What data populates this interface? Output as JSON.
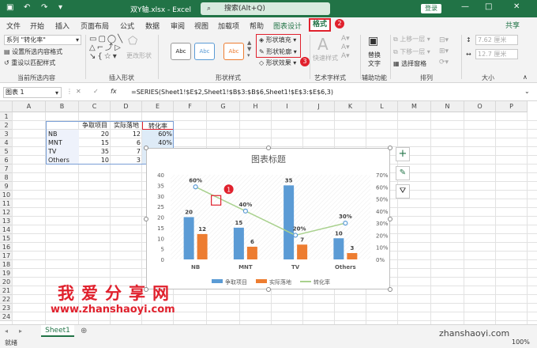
{
  "titlebar": {
    "autosave_icon": "save-icon",
    "undo_icon": "undo-icon",
    "redo_icon": "redo-icon",
    "doc_title": "双Y轴.xlsx - Excel",
    "search_placeholder": "搜索(Alt+Q)",
    "login_label": "登录",
    "min": "—",
    "max": "□",
    "close": "✕"
  },
  "menu": {
    "tabs": [
      "文件",
      "开始",
      "插入",
      "页面布局",
      "公式",
      "数据",
      "审阅",
      "视图",
      "加载项",
      "帮助",
      "图表设计"
    ],
    "active_tab": "格式",
    "share": "共享"
  },
  "badges": {
    "b1": "1",
    "b2": "2",
    "b3": "3"
  },
  "ribbon": {
    "current_select": {
      "dropdown_value": "系列 \"转化率\"",
      "format_selection": "设置所选内容格式",
      "reset_style": "重设以匹配样式",
      "group_label": "当前所选内容"
    },
    "insert_shapes": {
      "change_shape": "更改形状",
      "group_label": "插入形状"
    },
    "shape_styles": {
      "preset": [
        "Abc",
        "Abc",
        "Abc"
      ],
      "fill": "形状填充",
      "outline": "形状轮廓",
      "effect": "形状效果",
      "group_label": "形状样式"
    },
    "art_styles": {
      "quick": "快速样式",
      "group_label": "艺术字样式"
    },
    "accessibility": {
      "alt_text_line1": "替换",
      "alt_text_line2": "文字",
      "group_label": "辅助功能"
    },
    "arrange": {
      "bring_forward": "上移一层",
      "send_backward": "下移一层",
      "selection_pane": "选择窗格",
      "group_label": "排列"
    },
    "size": {
      "height": "7.62 厘米",
      "width": "12.7 厘米",
      "group_label": "大小"
    }
  },
  "formula_bar": {
    "name_box": "图表 1",
    "fx": "fx",
    "formula": "=SERIES(Sheet1!$E$2,Sheet1!$B$3:$B$6,Sheet1!$E$3:$E$6,3)"
  },
  "sheet": {
    "columns": [
      "A",
      "B",
      "C",
      "D",
      "E",
      "F",
      "G",
      "H",
      "I",
      "J",
      "K",
      "L",
      "M",
      "N",
      "O",
      "P"
    ],
    "rows": [
      "1",
      "2",
      "3",
      "4",
      "5",
      "6",
      "7",
      "8",
      "9",
      "10",
      "11",
      "12",
      "13",
      "14",
      "15",
      "16",
      "17",
      "18",
      "19",
      "20",
      "21",
      "22",
      "23",
      "24"
    ],
    "header_row": [
      "",
      "争取项目",
      "实际落地",
      "转化率"
    ],
    "data": [
      [
        "NB",
        "20",
        "12",
        "60%"
      ],
      [
        "MNT",
        "15",
        "6",
        "40%"
      ],
      [
        "TV",
        "35",
        "7",
        "20%"
      ],
      [
        "Others",
        "10",
        "3",
        "30%"
      ]
    ]
  },
  "chart_data": {
    "type": "bar",
    "title": "图表标题",
    "categories": [
      "NB",
      "MNT",
      "TV",
      "Others"
    ],
    "series": [
      {
        "name": "争取项目",
        "type": "bar",
        "axis": "left",
        "values": [
          20,
          15,
          35,
          10
        ],
        "labels": [
          "20",
          "15",
          "35",
          "10"
        ],
        "color": "#5b9bd5"
      },
      {
        "name": "实际落地",
        "type": "bar",
        "axis": "left",
        "values": [
          12,
          6,
          7,
          3
        ],
        "labels": [
          "12",
          "6",
          "7",
          "3"
        ],
        "color": "#ed7d31"
      },
      {
        "name": "转化率",
        "type": "line",
        "axis": "right",
        "values": [
          0.6,
          0.4,
          0.2,
          0.3
        ],
        "labels": [
          "60%",
          "40%",
          "20%",
          "30%"
        ],
        "color": "#a9d18e"
      }
    ],
    "left_axis": {
      "ticks": [
        "0",
        "5",
        "10",
        "15",
        "20",
        "25",
        "30",
        "35",
        "40"
      ],
      "ylim": [
        0,
        40
      ]
    },
    "right_axis": {
      "ticks": [
        "0%",
        "10%",
        "20%",
        "30%",
        "40%",
        "50%",
        "60%",
        "70%"
      ],
      "ylim": [
        0,
        0.7
      ]
    },
    "legend": "bottom",
    "grid": false
  },
  "chart_side_buttons": {
    "add": "+",
    "brush": "brush-icon",
    "filter": "filter-icon"
  },
  "watermark": {
    "line1": "我爱分享网",
    "line2": "www.zhanshaoyi.com",
    "line3": "zhanshaoyi.com"
  },
  "sheet_tabs": {
    "active": "Sheet1"
  },
  "status": {
    "mode": "就绪",
    "zoom": "100%"
  }
}
